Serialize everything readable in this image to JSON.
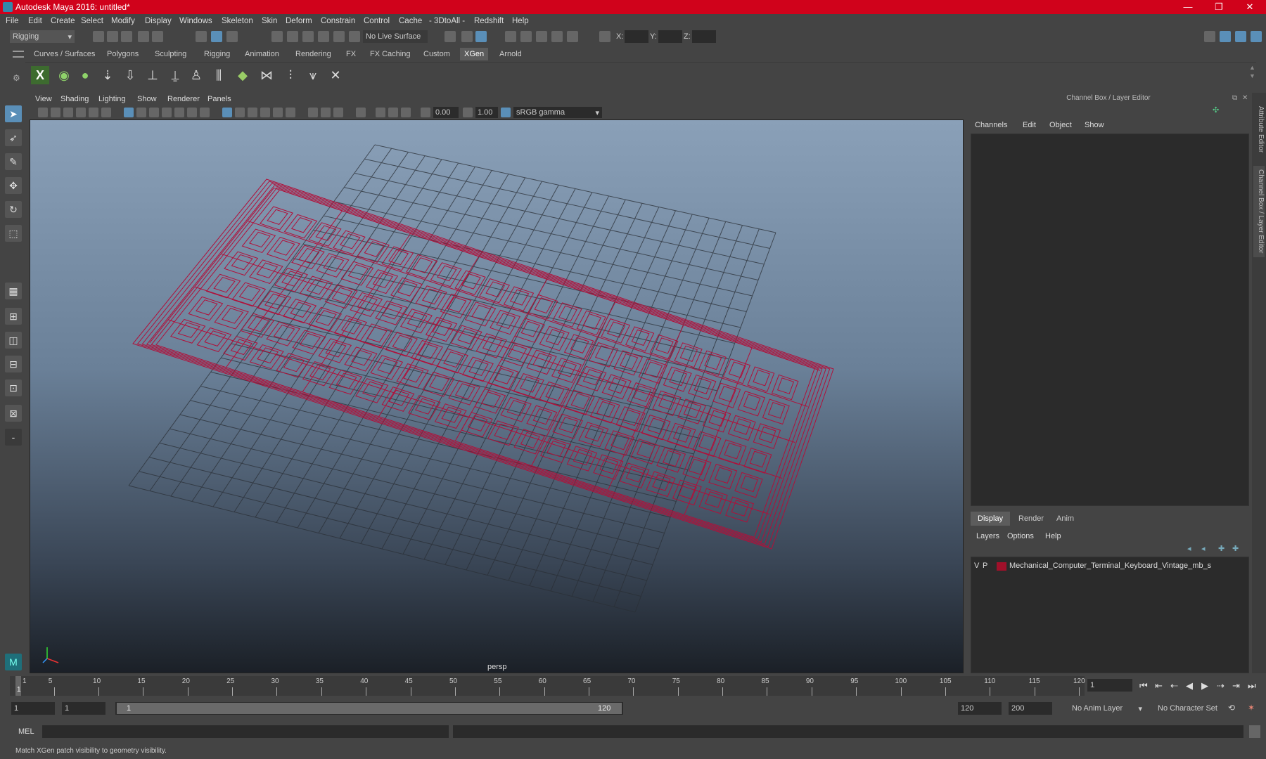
{
  "window": {
    "title": "Autodesk Maya 2016: untitled*",
    "minimize": "—",
    "maximize": "❐",
    "close": "✕"
  },
  "menu": [
    "File",
    "Edit",
    "Create",
    "Select",
    "Modify",
    "Display",
    "Windows",
    "Skeleton",
    "Skin",
    "Deform",
    "Constrain",
    "Control",
    "Cache",
    "- 3DtoAll -",
    "Redshift",
    "Help"
  ],
  "toolbar": {
    "mode": "Rigging",
    "live_surface": "No Live Surface",
    "x_label": "X:",
    "y_label": "Y:",
    "z_label": "Z:"
  },
  "shelf_tabs": [
    "Curves / Surfaces",
    "Polygons",
    "Sculpting",
    "Rigging",
    "Animation",
    "Rendering",
    "FX",
    "FX Caching",
    "Custom",
    "XGen",
    "Arnold"
  ],
  "shelf_active": "XGen",
  "viewport": {
    "menu": [
      "View",
      "Shading",
      "Lighting",
      "Show",
      "Renderer",
      "Panels"
    ],
    "exposure": "0.00",
    "gamma": "1.00",
    "colorspace": "sRGB gamma",
    "camera_label": "persp"
  },
  "channel_box": {
    "title": "Channel Box / Layer Editor",
    "menu": [
      "Channels",
      "Edit",
      "Object",
      "Show"
    ],
    "layer_tabs": [
      "Display",
      "Render",
      "Anim"
    ],
    "layer_tab_active": "Display",
    "layer_menu": [
      "Layers",
      "Options",
      "Help"
    ],
    "layer": {
      "v": "V",
      "p": "P",
      "name": "Mechanical_Computer_Terminal_Keyboard_Vintage_mb_s",
      "color": "#a0102a"
    }
  },
  "side_tabs": [
    "Attribute Editor",
    "Channel Box / Layer Editor"
  ],
  "timeline": {
    "ticks": [
      "1",
      "5",
      "10",
      "15",
      "20",
      "25",
      "30",
      "35",
      "40",
      "45",
      "50",
      "55",
      "60",
      "65",
      "70",
      "75",
      "80",
      "85",
      "90",
      "95",
      "100",
      "105",
      "110",
      "115",
      "120"
    ],
    "current_frame": "1"
  },
  "range": {
    "start": "1",
    "start2": "1",
    "slider_start": "1",
    "slider_end": "120",
    "end": "120",
    "end2": "200",
    "anim_layer": "No Anim Layer",
    "char_set": "No Character Set"
  },
  "mel": {
    "label": "MEL"
  },
  "status": "Match XGen patch visibility to geometry visibility.",
  "colors": {
    "titlebar": "#d0021b",
    "wireframe": "#b0103a",
    "accent": "#5a8fb8"
  }
}
